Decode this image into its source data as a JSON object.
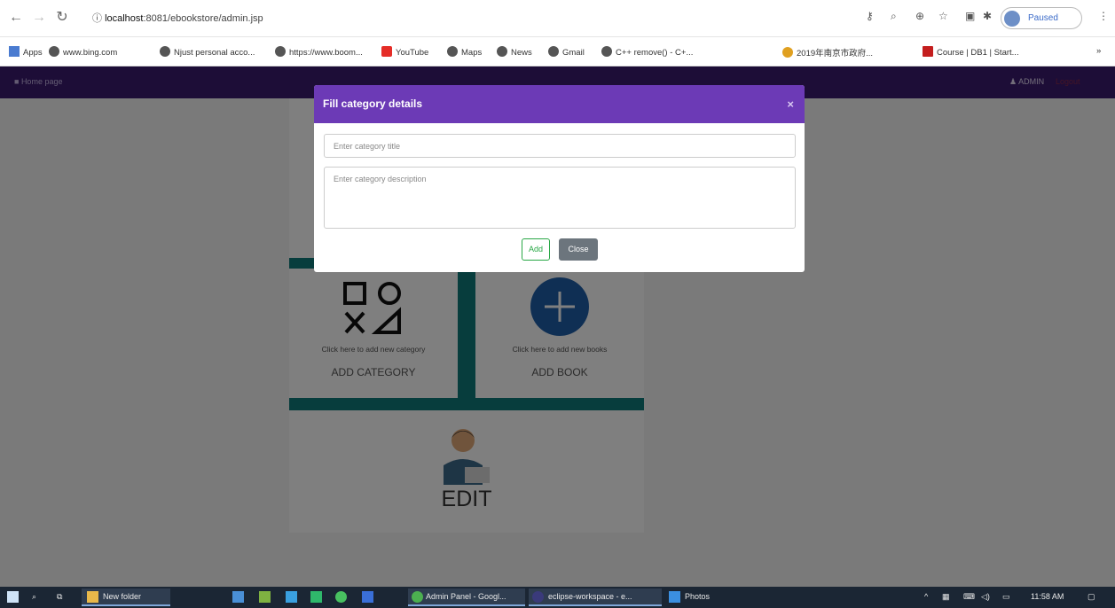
{
  "browser": {
    "url_host": "localhost",
    "url_path": ":8081/ebookstore/admin.jsp",
    "profile_label": "Paused",
    "bookmarks": [
      {
        "label": "Apps"
      },
      {
        "label": "www.bing.com"
      },
      {
        "label": "Njust personal acco..."
      },
      {
        "label": "https://www.boom..."
      },
      {
        "label": "YouTube"
      },
      {
        "label": "Maps"
      },
      {
        "label": "News"
      },
      {
        "label": "Gmail"
      },
      {
        "label": "C++ remove() - C+..."
      },
      {
        "label": "2019年南京市政府..."
      },
      {
        "label": "Course | DB1 | Start..."
      }
    ]
  },
  "navbar": {
    "brand": "Home page",
    "admin_label": "ADMIN",
    "logout_label": "Logout"
  },
  "dashboard": {
    "add_category": {
      "hint": "Click here to add new category",
      "title": "ADD CATEGORY"
    },
    "add_book": {
      "hint": "Click here to add new books",
      "title": "ADD BOOK"
    },
    "edit": {
      "title": "EDIT"
    }
  },
  "modal": {
    "title": "Fill category details",
    "title_placeholder": "Enter category title",
    "description_placeholder": "Enter category description",
    "add_label": "Add",
    "close_label": "Close"
  },
  "taskbar": {
    "items": [
      {
        "label": "New folder"
      },
      {
        "label": "Admin Panel - Googl..."
      },
      {
        "label": "eclipse-workspace - e..."
      },
      {
        "label": "Photos"
      }
    ],
    "time": "11:58 AM"
  },
  "colors": {
    "navbar": "#3b1a6f",
    "modal_header": "#6c3ab6",
    "teal": "#0f7a7a",
    "close_button": "#6c757d",
    "add_border": "#28a745",
    "plus_circle": "#1f5fa8"
  }
}
